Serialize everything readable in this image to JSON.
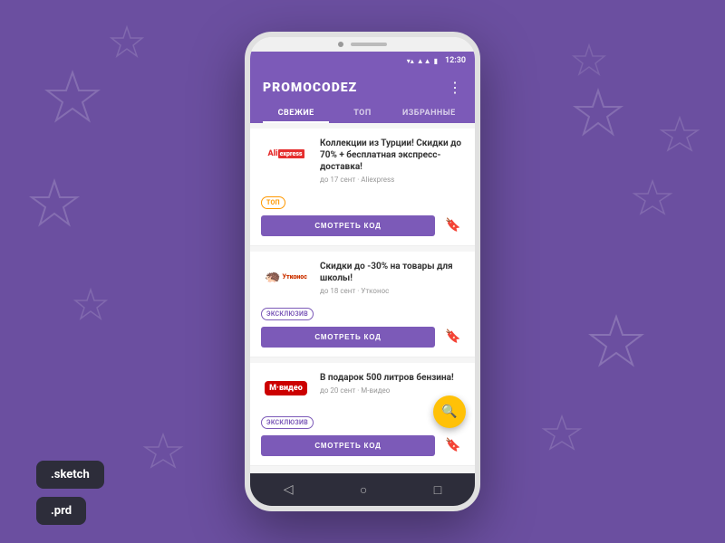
{
  "background": {
    "color": "#6b4fa0"
  },
  "badges": [
    {
      "label": ".sketch",
      "id": "sketch-badge"
    },
    {
      "label": ".prd",
      "id": "prd-badge"
    }
  ],
  "phone": {
    "status_bar": {
      "time": "12:30",
      "icons": [
        "▼",
        "▲",
        "▲▲",
        "🔋"
      ]
    },
    "header": {
      "title": "PROMOCODEZ",
      "menu_icon": "⋮"
    },
    "tabs": [
      {
        "label": "СВЕЖИЕ",
        "active": true
      },
      {
        "label": "ТОП",
        "active": false
      },
      {
        "label": "ИЗБРАННЫЕ",
        "active": false
      }
    ],
    "cards": [
      {
        "brand": "AliExpress",
        "brand_type": "aliexpress",
        "tag": "ТОП",
        "tag_style": "top",
        "title": "Коллекции из Турции! Скидки до 70% + бесплатная экспресс-доставка!",
        "meta": "до 17 сент · Aliexpress",
        "btn_label": "СМОТРЕТЬ КОД",
        "bookmark": "empty"
      },
      {
        "brand": "Утконос",
        "brand_type": "utkonos",
        "tag": "ЭКСКЛЮЗИВ",
        "tag_style": "exclusive",
        "title": "Скидки до -30% на товары для школы!",
        "meta": "до 18 сент · Утконос",
        "btn_label": "СМОТРЕТЬ КОД",
        "bookmark": "filled"
      },
      {
        "brand": "М-видео",
        "brand_type": "mvideo",
        "tag": "ЭКСКЛЮЗИВ",
        "tag_style": "exclusive",
        "title": "В подарок 500 литров бензина!",
        "meta": "до 20 сент · М-видео",
        "btn_label": "СМОТРЕТЬ КОД",
        "bookmark": "empty"
      }
    ],
    "fab_icon": "🔍",
    "bottom_nav": [
      "◁",
      "○",
      "□"
    ]
  }
}
